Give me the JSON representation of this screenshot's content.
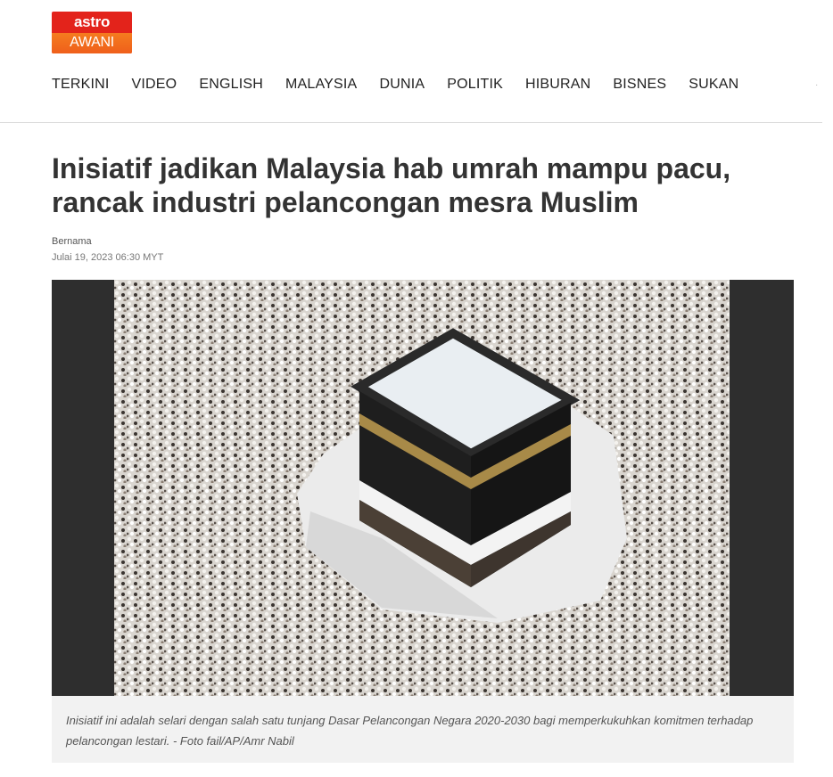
{
  "header": {
    "logo": {
      "top_text": "astro",
      "bottom_text": "AWANI",
      "brand_red": "#e3231b",
      "brand_orange": "#f26a1e"
    },
    "nav": [
      "TERKINI",
      "VIDEO",
      "ENGLISH",
      "MALAYSIA",
      "DUNIA",
      "POLITIK",
      "HIBURAN",
      "BISNES",
      "SUKAN"
    ]
  },
  "article": {
    "title": "Inisiatif jadikan Malaysia hab umrah mampu pacu, rancak industri pelancongan mesra Muslim",
    "author": "Bernama",
    "date": "Julai 19, 2023 06:30 MYT",
    "caption": "Inisiatif ini adalah selari dengan salah satu tunjang Dasar Pelancongan Negara 2020-2030 bagi memperkukuhkan komitmen terhadap pelancongan lestari. - Foto fail/AP/Amr Nabil"
  }
}
